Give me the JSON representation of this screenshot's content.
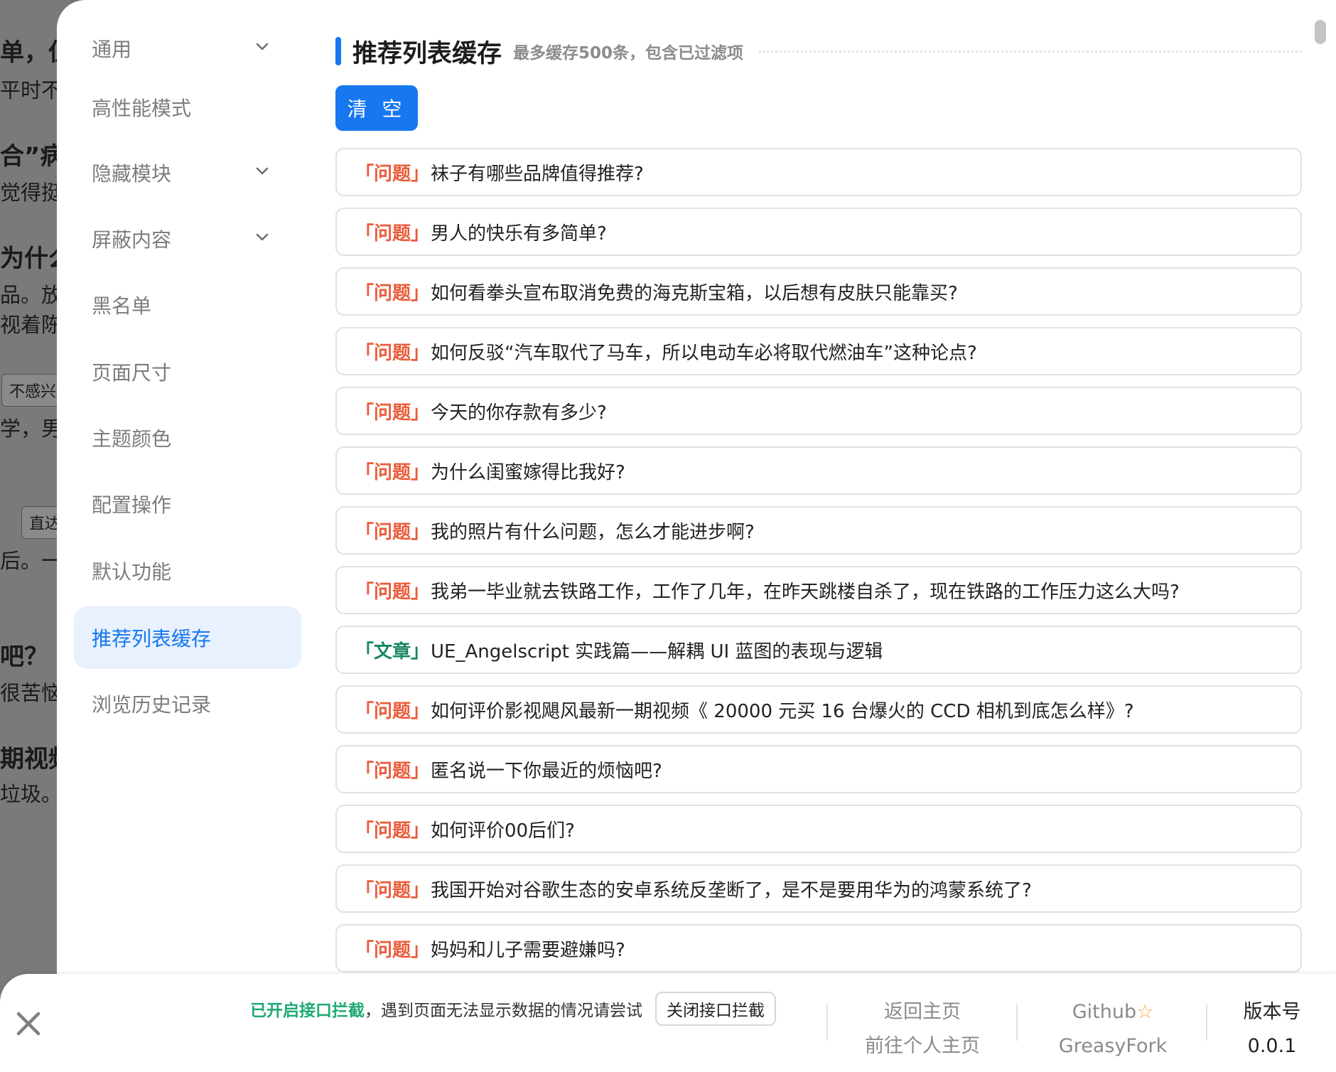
{
  "background_fragments": [
    "单，但",
    "平时不",
    "合”病",
    "觉得挺",
    "为什么",
    "品。放",
    "视着陈",
    "不感兴趣",
    "学，男",
    "直达",
    "后。一",
    "吧？",
    "很苦恼",
    "期视频",
    "垃圾。"
  ],
  "sidebar": {
    "items": [
      {
        "label": "通用",
        "has_chevron": true
      },
      {
        "label": "高性能模式",
        "has_chevron": false
      },
      {
        "label": "隐藏模块",
        "has_chevron": true
      },
      {
        "label": "屏蔽内容",
        "has_chevron": true
      },
      {
        "label": "黑名单",
        "has_chevron": false
      },
      {
        "label": "页面尺寸",
        "has_chevron": false
      },
      {
        "label": "主题颜色",
        "has_chevron": false
      },
      {
        "label": "配置操作",
        "has_chevron": false
      },
      {
        "label": "默认功能",
        "has_chevron": false
      },
      {
        "label": "推荐列表缓存",
        "has_chevron": false,
        "active": true
      },
      {
        "label": "浏览历史记录",
        "has_chevron": false
      }
    ]
  },
  "section": {
    "title": "推荐列表缓存",
    "subtitle": "最多缓存500条，包含已过滤项",
    "clear_label": "清 空"
  },
  "cache_items": [
    {
      "type": "「问题」",
      "kind": "q",
      "text": "袜子有哪些品牌值得推荐?"
    },
    {
      "type": "「问题」",
      "kind": "q",
      "text": "男人的快乐有多简单?"
    },
    {
      "type": "「问题」",
      "kind": "q",
      "text": "如何看拳头宣布取消免费的海克斯宝箱，以后想有皮肤只能靠买?"
    },
    {
      "type": "「问题」",
      "kind": "q",
      "text": "如何反驳“汽车取代了马车，所以电动车必将取代燃油车”这种论点?"
    },
    {
      "type": "「问题」",
      "kind": "q",
      "text": "今天的你存款有多少?"
    },
    {
      "type": "「问题」",
      "kind": "q",
      "text": "为什么闺蜜嫁得比我好?"
    },
    {
      "type": "「问题」",
      "kind": "q",
      "text": "我的照片有什么问题，怎么才能进步啊?"
    },
    {
      "type": "「问题」",
      "kind": "q",
      "text": "我弟一毕业就去铁路工作，工作了几年，在昨天跳楼自杀了，现在铁路的工作压力这么大吗?"
    },
    {
      "type": "「文章」",
      "kind": "a",
      "text": "UE_Angelscript 实践篇——解耦 UI 蓝图的表现与逻辑"
    },
    {
      "type": "「问题」",
      "kind": "q",
      "text": "如何评价影视飓风最新一期视频《 20000 元买 16 台爆火的 CCD 相机到底怎么样》?"
    },
    {
      "type": "「问题」",
      "kind": "q",
      "text": "匿名说一下你最近的烦恼吧?"
    },
    {
      "type": "「问题」",
      "kind": "q",
      "text": "如何评价00后们?"
    },
    {
      "type": "「问题」",
      "kind": "q",
      "text": "我国开始对谷歌生态的安卓系统反垄断了，是不是要用华为的鸿蒙系统了?"
    },
    {
      "type": "「问题」",
      "kind": "q",
      "text": "妈妈和儿子需要避嫌吗?"
    }
  ],
  "footer": {
    "intercept_status": "已开启接口拦截",
    "intercept_hint": "，遇到页面无法显示数据的情况请尝试",
    "intercept_button": "关闭接口拦截",
    "home_link": "返回主页",
    "profile_link": "前往个人主页",
    "github_link": "Github",
    "greasyfork_link": "GreasyFork",
    "version_label": "版本号",
    "version_value": "0.0.1"
  },
  "colors": {
    "accent": "#1677f0",
    "question": "#ea5b3a",
    "article": "#17875c",
    "intercept_on": "#1faa74"
  },
  "icons": {
    "close": "close-icon",
    "chevron": "chevron-down-icon",
    "star": "star-icon"
  }
}
